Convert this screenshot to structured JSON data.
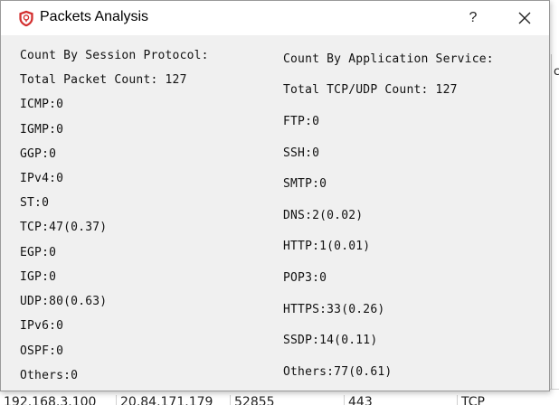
{
  "window": {
    "title": "Packets Analysis",
    "help_label": "?"
  },
  "session_protocol": {
    "heading": "Count By Session Protocol:",
    "total": "Total Packet Count: 127",
    "items": [
      "ICMP:0",
      "IGMP:0",
      "GGP:0",
      "IPv4:0",
      "ST:0",
      "TCP:47(0.37)",
      "EGP:0",
      "IGP:0",
      "UDP:80(0.63)",
      "IPv6:0",
      "OSPF:0",
      "Others:0"
    ]
  },
  "application_service": {
    "heading": "Count By Application Service:",
    "total": "Total TCP/UDP Count: 127",
    "items": [
      "FTP:0",
      "SSH:0",
      "SMTP:0",
      "DNS:2(0.02)",
      "HTTP:1(0.01)",
      "POP3:0",
      "HTTPS:33(0.26)",
      "SSDP:14(0.11)",
      "Others:77(0.61)"
    ]
  },
  "background": {
    "right_fragment": "co",
    "row_cells": [
      "192.168.3.100",
      "20.84.171.179",
      "52855",
      "443",
      "TCP"
    ]
  },
  "colors": {
    "icon_red": "#d32f2f",
    "dialog_bg": "#f0f0f0",
    "titlebar_bg": "#ffffff"
  }
}
